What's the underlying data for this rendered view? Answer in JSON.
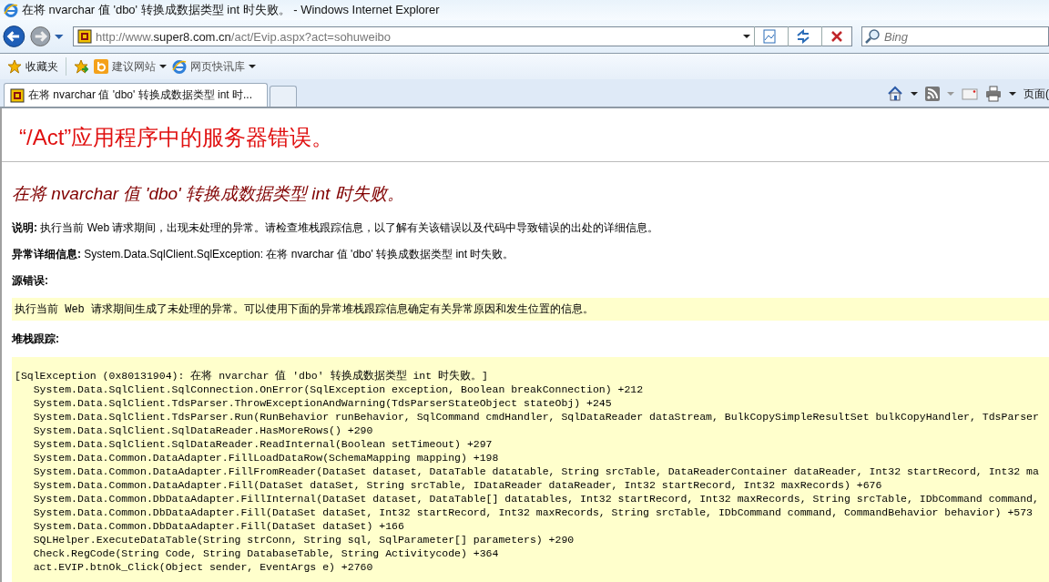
{
  "window": {
    "title": "在将 nvarchar 值 'dbo' 转换成数据类型 int 时失败。 - Windows Internet Explorer"
  },
  "nav": {
    "url": "http://www.**super8.com.cn**/act/Evip.aspx?act=sohuweibo",
    "search_placeholder": "Bing"
  },
  "favorites_bar": {
    "favorites": "收藏夹",
    "items": [
      {
        "label": "建议网站",
        "kind": "bing"
      },
      {
        "label": "网页快讯库",
        "kind": "ie"
      }
    ]
  },
  "tabs": [
    {
      "label": "在将 nvarchar 值 'dbo' 转换成数据类型 int 时...",
      "selected": true
    }
  ],
  "command_bar": {
    "page_menu": "页面("
  },
  "page": {
    "heading": "“/Act”应用程序中的服务器错误。",
    "error_title": "在将 nvarchar 值 'dbo' 转换成数据类型 int 时失败。",
    "description": "**说明:** 执行当前 Web 请求期间，出现未处理的异常。请检查堆栈跟踪信息，以了解有关该错误以及代码中导致错误的出处的详细信息。",
    "exception_details": "**异常详细信息:** System.Data.SqlClient.SqlException: 在将 nvarchar 值 'dbo' 转换成数据类型 int 时失败。",
    "source_error_label": "源错误:",
    "source_error_text": "执行当前 Web 请求期间生成了未处理的异常。可以使用下面的异常堆栈跟踪信息确定有关异常原因和发生位置的信息。",
    "stack_trace_label": "堆栈跟踪:",
    "stack_trace": [
      "[SqlException (0x80131904): 在将 nvarchar 值 'dbo' 转换成数据类型 int 时失败。]",
      "   System.Data.SqlClient.SqlConnection.OnError(SqlException exception, Boolean breakConnection) +212",
      "   System.Data.SqlClient.TdsParser.ThrowExceptionAndWarning(TdsParserStateObject stateObj) +245",
      "   System.Data.SqlClient.TdsParser.Run(RunBehavior runBehavior, SqlCommand cmdHandler, SqlDataReader dataStream, BulkCopySimpleResultSet bulkCopyHandler, TdsParser",
      "   System.Data.SqlClient.SqlDataReader.HasMoreRows() +290",
      "   System.Data.SqlClient.SqlDataReader.ReadInternal(Boolean setTimeout) +297",
      "   System.Data.Common.DataAdapter.FillLoadDataRow(SchemaMapping mapping) +198",
      "   System.Data.Common.DataAdapter.FillFromReader(DataSet dataset, DataTable datatable, String srcTable, DataReaderContainer dataReader, Int32 startRecord, Int32 ma",
      "   System.Data.Common.DataAdapter.Fill(DataSet dataSet, String srcTable, IDataReader dataReader, Int32 startRecord, Int32 maxRecords) +676",
      "   System.Data.Common.DbDataAdapter.FillInternal(DataSet dataset, DataTable[] datatables, Int32 startRecord, Int32 maxRecords, String srcTable, IDbCommand command,",
      "   System.Data.Common.DbDataAdapter.Fill(DataSet dataSet, Int32 startRecord, Int32 maxRecords, String srcTable, IDbCommand command, CommandBehavior behavior) +573",
      "   System.Data.Common.DbDataAdapter.Fill(DataSet dataSet) +166",
      "   SQLHelper.ExecuteDataTable(String strConn, String sql, SqlParameter[] parameters) +290",
      "   Check.RegCode(String Code, String DatabaseTable, String Activitycode) +364",
      "   act.EVIP.btnOk_Click(Object sender, EventArgs e) +2760"
    ]
  }
}
